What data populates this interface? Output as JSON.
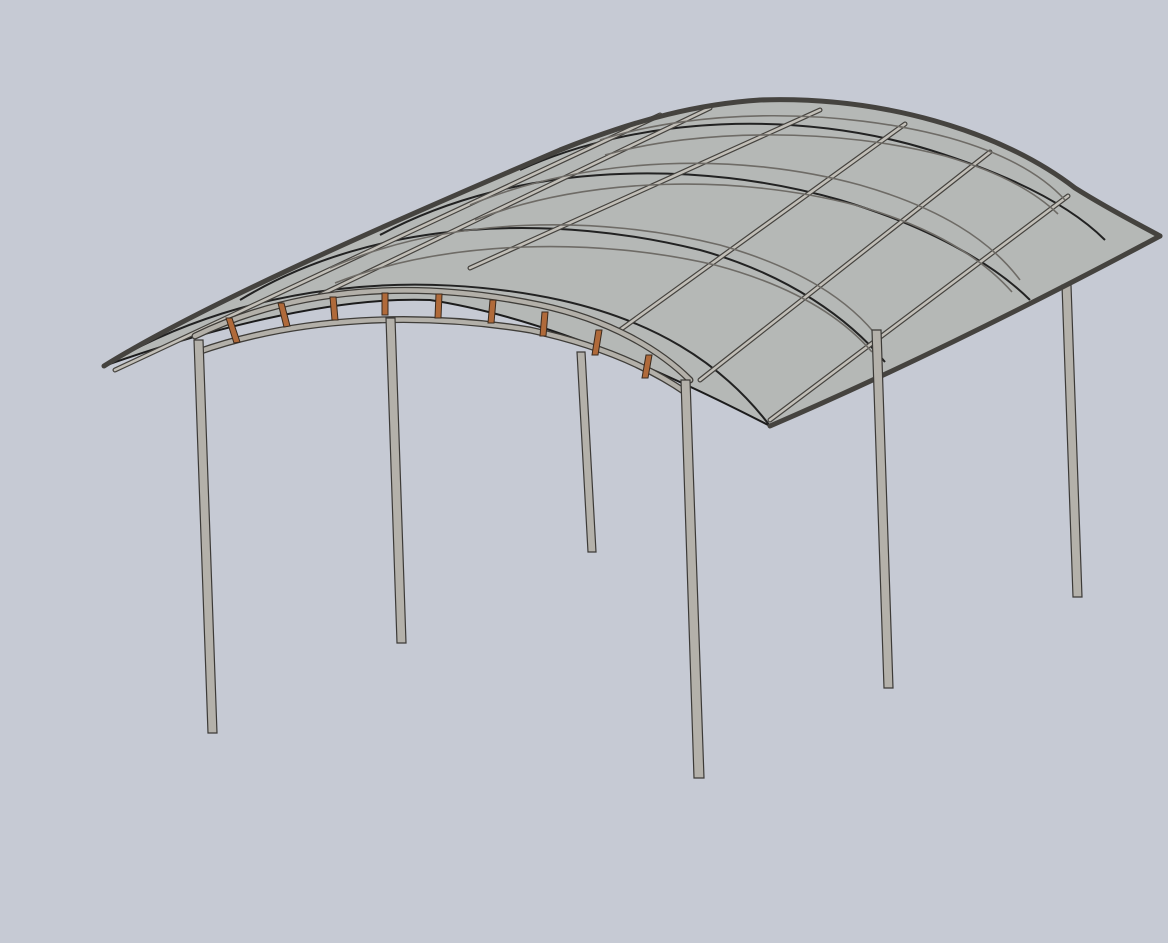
{
  "scene": {
    "background_color": "#c6cad4",
    "roof_color": "#a7a99c",
    "frame_color": "#b4b1aa",
    "edge_color": "#1c1c1c",
    "accent_color": "#b06a3a"
  },
  "structure": {
    "post_count": 6,
    "arched_truss_count": 4,
    "purlin_count": 6
  }
}
